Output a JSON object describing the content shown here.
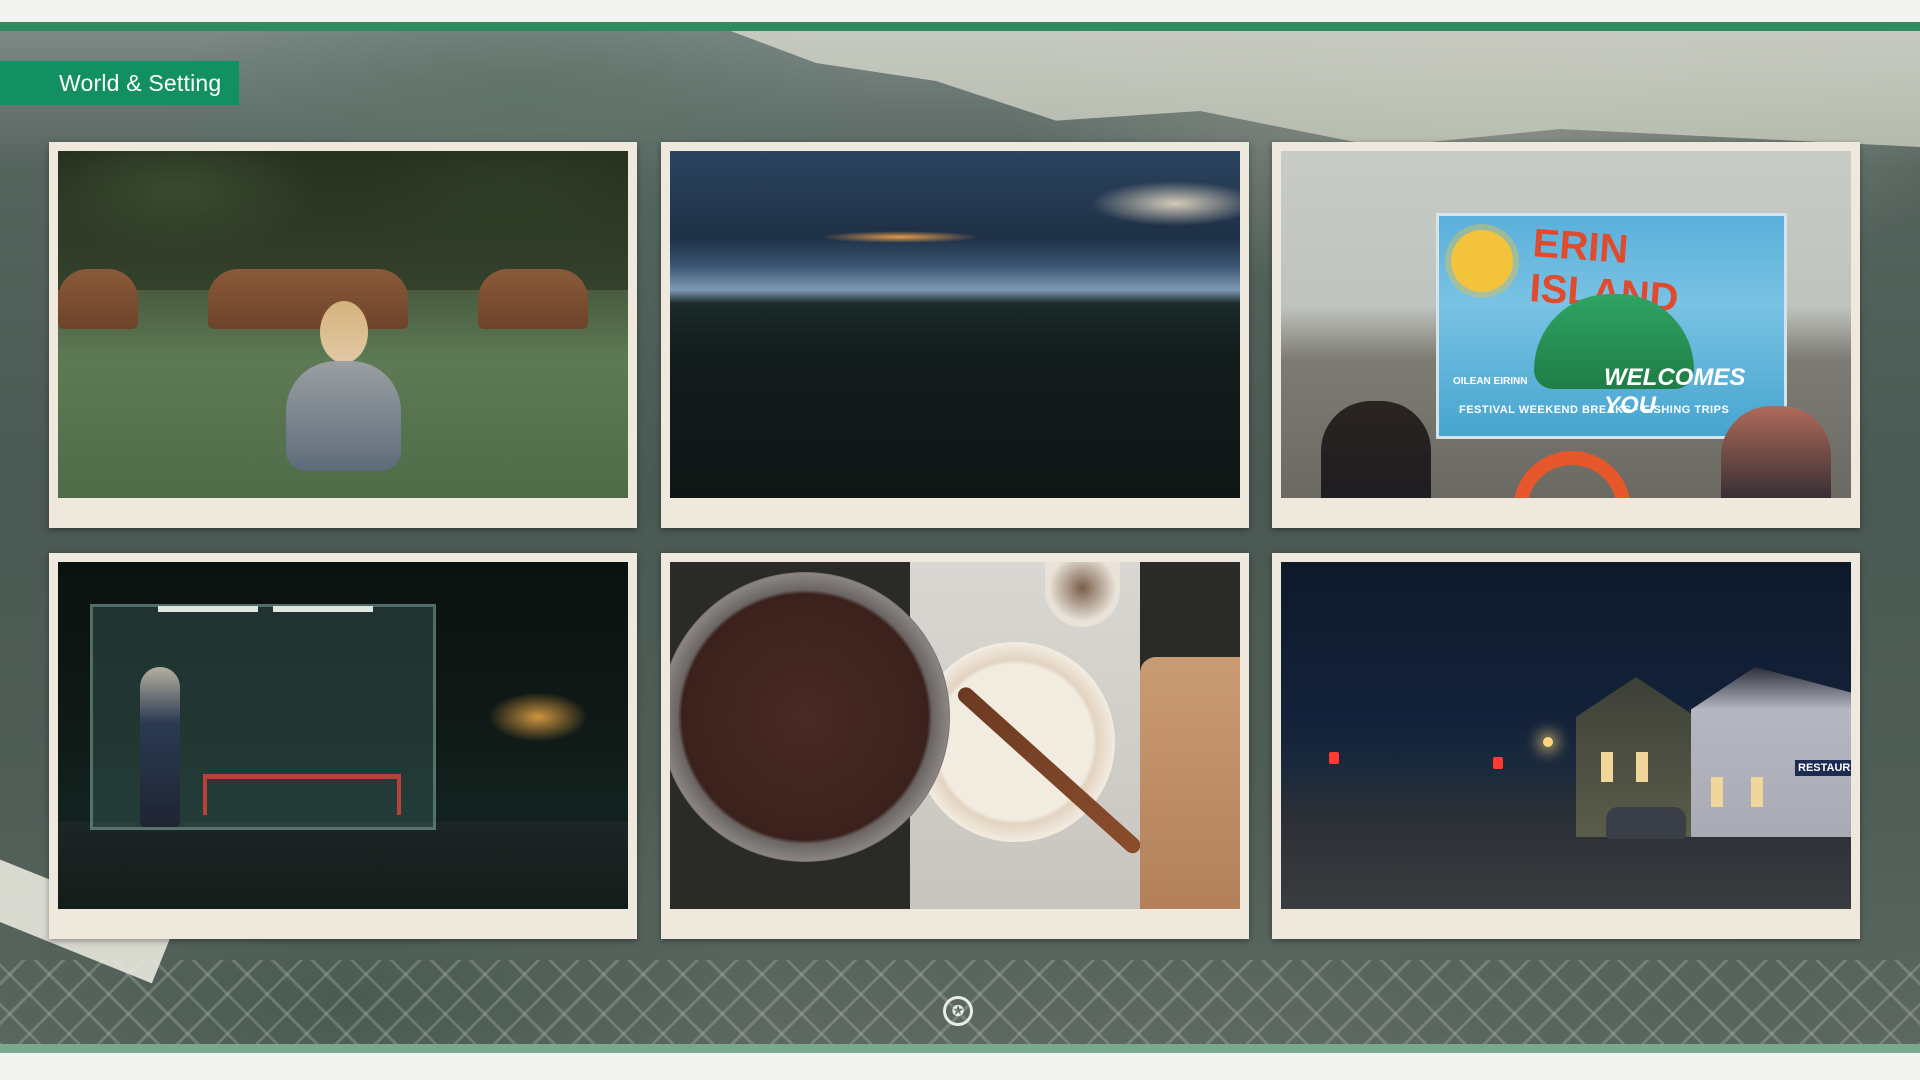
{
  "section": {
    "label": "World & Setting"
  },
  "photos": [
    {
      "name": "photo-girl-in-field"
    },
    {
      "name": "photo-dusk-landscape"
    },
    {
      "name": "photo-erin-island-sign",
      "sign": {
        "title": "ERIN ISLAND",
        "subtitle": "WELCOMES YOU",
        "gaelic": "OILEAN EIRINN",
        "footer": "FESTIVAL WEEKEND BREAKS · FISHING TRIPS"
      }
    },
    {
      "name": "photo-bus-stop-night"
    },
    {
      "name": "photo-cooking-pot"
    },
    {
      "name": "photo-village-street-night",
      "sign_text": "RESTAURANT"
    }
  ],
  "emblem": {
    "icon": "star-emblem-icon",
    "glyph": "✪"
  },
  "colors": {
    "accent_green": "#139061",
    "top_bar": "#2e8b5e",
    "bottom_bar": "#79a98e",
    "photo_frame": "#efe9dd"
  }
}
